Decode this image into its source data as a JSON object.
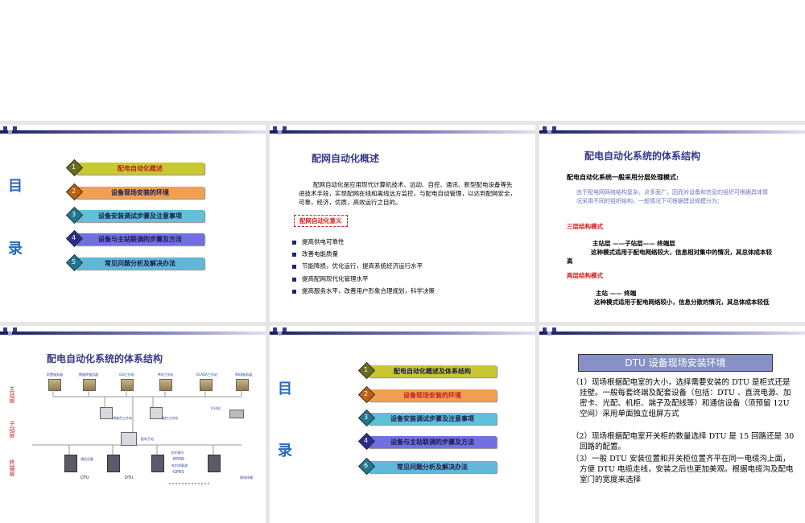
{
  "slide1": {
    "mulu": [
      "目",
      "录"
    ],
    "toc": [
      {
        "num": "1",
        "label": "配电自动化概述"
      },
      {
        "num": "2",
        "label": "设备现场安装的环境"
      },
      {
        "num": "3",
        "label": "设备安装调试步骤及注意事项"
      },
      {
        "num": "4",
        "label": "设备与主站联调的步骤及方法"
      },
      {
        "num": "5",
        "label": "常见问题分析及解决办法"
      }
    ]
  },
  "slide2": {
    "title": "配网自动化概述",
    "para": "配网自动化是应用现代计算机技术、远动、自控、通讯、新型配电设备等先进技术手段，实现配网在线和离线远方监控，与配电自动管理，以达到配网安全，可靠，经济，优质，高效运行之目的。",
    "subhead": "配网自动化意义",
    "bullets": [
      "提高供电可靠性",
      "改善电能质量",
      "节能降损，优化运行，提高系统经济运行水平",
      "提高配网现代化管理水平",
      "提高服务水平，改善用户形象合理规划，科学决策"
    ]
  },
  "slide3": {
    "title": "配电自动化系统的体系结构",
    "lead": "配电自动化系统一般采用分层处理模式:",
    "note": "由于配电网网络结构复杂，点多面广，因而对设备和信息的组织可根据具体情况采用不同的组织结构，一般情况下可根据建设规模分为：",
    "three_head": "三层结构模式",
    "three_line": "主站层 ——子站层—— 终端层",
    "three_desc": "这种模式适用于配电网络较大，信息相对集中的情况，其总体成本较高",
    "two_head": "两层结构模式",
    "two_line": "主站 —— 终端",
    "two_desc": "这种模式适用于配电网络较小，信息分散的情况，其总体成本较低"
  },
  "slide4": {
    "title": "配电自动化系统的体系结构",
    "layers": [
      "主站层",
      "子站层",
      "终端层"
    ],
    "servers": [
      "前置服务器",
      "数据库服务器",
      "GIS工作站",
      "MIS工作站",
      "SCADA工作站",
      "WEB服务器"
    ],
    "ws_labels": [
      "调度员工作站",
      "维护工作站",
      "打印机"
    ],
    "sub_label": "配电子站",
    "term_labels": [
      "通信设备",
      "光纤通讯",
      "EPON",
      "电力线载波",
      "GPRS",
      "DTU",
      "DTU",
      "馈线终端"
    ]
  },
  "slide5": {
    "mulu": [
      "目",
      "录"
    ],
    "toc": [
      {
        "num": "1",
        "label": "配电自动化概述及体系结构"
      },
      {
        "num": "2",
        "label": "设备现场安装的环境"
      },
      {
        "num": "3",
        "label": "设备安装调试步骤及注意事项"
      },
      {
        "num": "4",
        "label": "设备与主站联调的步骤及方法"
      },
      {
        "num": "6",
        "label": "常见问题分析及解决办法"
      }
    ]
  },
  "slide6": {
    "title": "DTU 设备现场安装环境",
    "paras": [
      "（1）现场根据配电室的大小，选择需要安装的 DTU 是柜式还是挂壁。一般每套终端及配套设备（包括：DTU 、直流电源、加密卡、光配、机柜、端子及配线等）和通信设备（须预留 12U 空间）采用单面独立组屏方式",
      "（2）现场根据配电室开关柜的数量选择 DTU 是 15 回路还是 30 回路的配置。",
      "（3）一般 DTU 安装位置和开关柜位置齐平在同一电缆沟上面，方便 DTU 电缆走线，安装之后也更加美观。根据电缆沟及配电室门的宽度来选择"
    ]
  },
  "colors": {
    "bar1": "#c8c832",
    "bar2": "#f0a050",
    "bar3": "#60c0d8",
    "bar4": "#7070e0",
    "bar5": "#60b8d8"
  }
}
